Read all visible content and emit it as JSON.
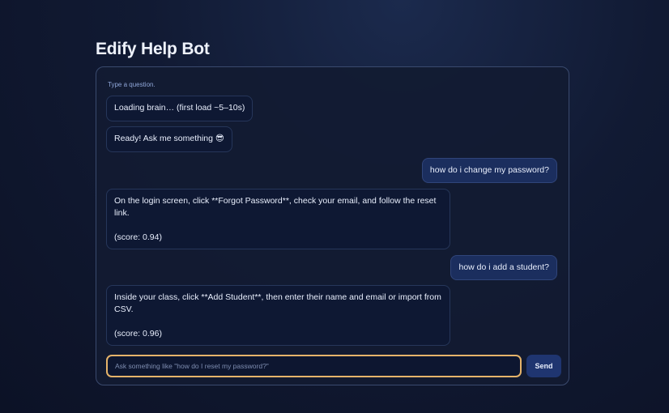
{
  "page": {
    "title": "Edify Help Bot"
  },
  "chat": {
    "hint": "Type a question.",
    "messages": [
      {
        "role": "bot",
        "text": "Loading brain… (first load ~5–10s)"
      },
      {
        "role": "bot",
        "text": "Ready! Ask me something 😎"
      },
      {
        "role": "user",
        "text": "how do i change my password?"
      },
      {
        "role": "bot",
        "text": "On the login screen, click **Forgot Password**, check your email, and follow the reset link.\n\n(score: 0.94)"
      },
      {
        "role": "user",
        "text": "how do i add a student?"
      },
      {
        "role": "bot",
        "text": "Inside your class, click **Add Student**, then enter their name and email or import from CSV.\n\n(score: 0.96)"
      }
    ]
  },
  "composer": {
    "placeholder": "Ask something like \"how do I reset my password?\"",
    "value": "",
    "send_label": "Send"
  },
  "colors": {
    "background": "#111a33",
    "panel_border": "#3a4a6e",
    "bot_bubble": "#0e1833",
    "user_bubble": "#1b2e5e",
    "input_focus_border": "#e5b36a",
    "send_button": "#1f3570"
  }
}
